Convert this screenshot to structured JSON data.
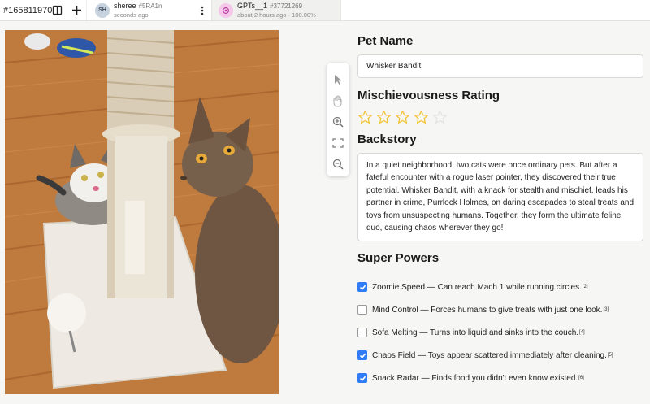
{
  "topbar": {
    "id": "#165811970",
    "user": {
      "initials": "SH",
      "name": "sheree",
      "tag": "#5RA1n",
      "time": "seconds ago"
    },
    "tab": {
      "name": "GPTs__1",
      "tag": "#37721269",
      "status": "about 2 hours ago · 100.00%"
    }
  },
  "tools": [
    "pointer-icon",
    "hand-icon",
    "zoom-in-icon",
    "fit-screen-icon",
    "zoom-out-icon"
  ],
  "pet_name": {
    "label": "Pet Name",
    "value": "Whisker Bandit"
  },
  "rating": {
    "label": "Mischievousness Rating",
    "value": 4,
    "max": 5,
    "color": "#f2c53a"
  },
  "backstory": {
    "label": "Backstory",
    "text": "In a quiet neighborhood, two cats were once ordinary pets. But after a fateful encounter with a rogue laser pointer, they discovered their true potential. Whisker Bandit, with a knack for stealth and mischief, leads his partner in crime, Purrlock Holmes, on daring escapades to steal treats and toys from unsuspecting humans. Together, they form the ultimate feline duo, causing chaos wherever they go!"
  },
  "powers": {
    "label": "Super Powers",
    "items": [
      {
        "text": "Zoomie Speed — Can reach Mach 1 while running circles.",
        "ref": "[2]",
        "checked": true
      },
      {
        "text": "Mind Control — Forces humans to give treats with just one look.",
        "ref": "[3]",
        "checked": false
      },
      {
        "text": "Sofa Melting — Turns into liquid and sinks into the couch.",
        "ref": "[4]",
        "checked": false
      },
      {
        "text": "Chaos Field — Toys appear scattered immediately after cleaning.",
        "ref": "[5]",
        "checked": true
      },
      {
        "text": "Snack Radar — Finds food you didn't even know existed.",
        "ref": "[6]",
        "checked": true
      }
    ]
  }
}
